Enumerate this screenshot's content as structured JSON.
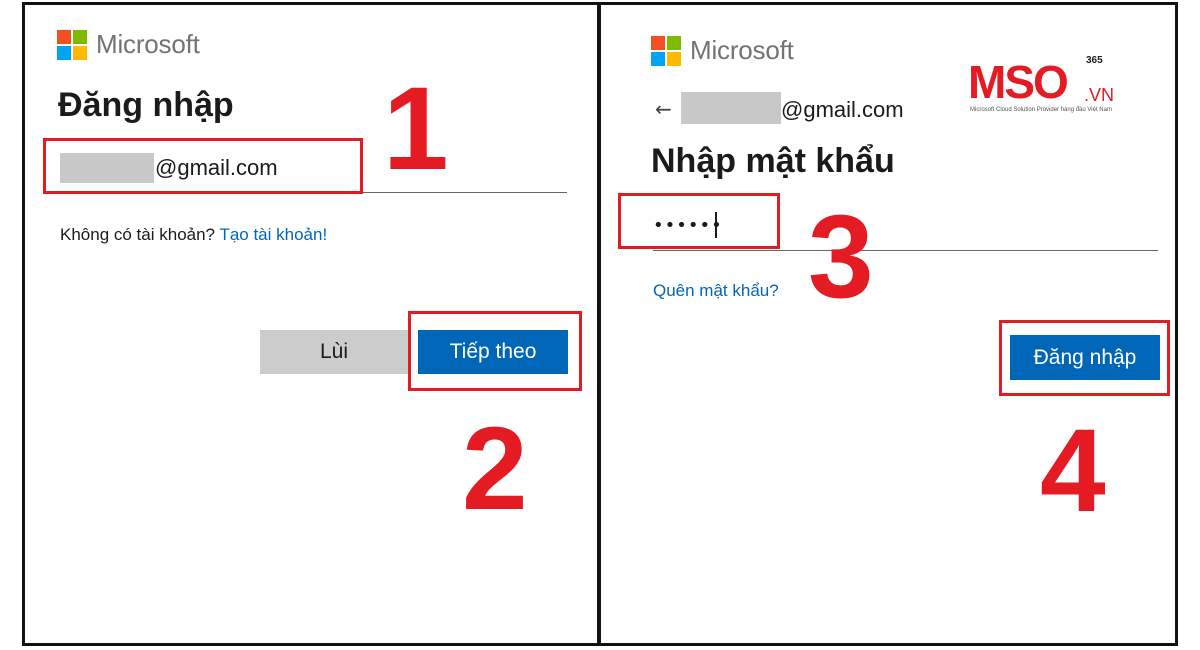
{
  "left_panel": {
    "brand": "Microsoft",
    "title": "Đăng nhập",
    "email_suffix": "@gmail.com",
    "no_account_text": "Không có tài khoản?",
    "create_account_link": "Tạo tài khoản!",
    "back_button": "Lùi",
    "next_button": "Tiếp theo",
    "step_email": "1",
    "step_next": "2"
  },
  "right_panel": {
    "brand": "Microsoft",
    "back_arrow": "←",
    "email_suffix": "@gmail.com",
    "title": "Nhập mật khẩu",
    "password_value": "••••••••",
    "forgot_password_link": "Quên mật khẩu?",
    "signin_button": "Đăng nhập",
    "step_password": "3",
    "step_signin": "4"
  },
  "watermark": {
    "main": "MSO",
    "superscript": "365",
    "suffix": ".VN",
    "tagline": "Microsoft Cloud Solution Provider hàng đầu Việt Nam"
  },
  "colors": {
    "accent_blue": "#0067b8",
    "annotation_red": "#e51b23",
    "ms_red": "#f25022",
    "ms_green": "#7fba00",
    "ms_blue": "#00a4ef",
    "ms_yellow": "#ffb900",
    "button_gray": "#cccccc"
  }
}
